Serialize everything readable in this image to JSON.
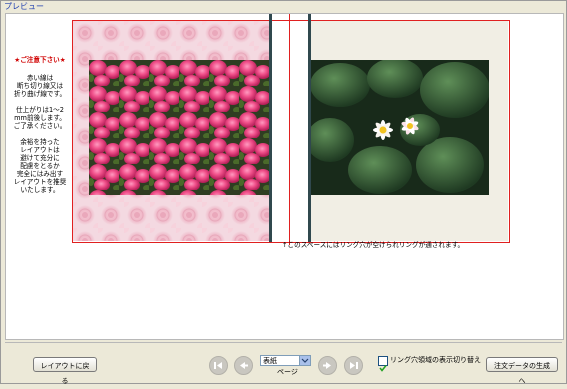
{
  "window": {
    "title": "プレビュー"
  },
  "notice": {
    "heading": "★ご注意下さい★",
    "paragraph1": "赤い線は\n断ち切り線又は\n折り曲げ線です。",
    "paragraph2": "仕上がりは1～2\nmm前後します。\nご了承ください。",
    "paragraph3": "余裕を持った\nレイアウトは\n避けて充分に\n配慮をとるか\n完全にはみ出す\nレイアウトを推奨\nいたします。"
  },
  "ring_note": "↑このスペースにはリング穴が空けられリングが通されます。",
  "controls": {
    "layout_back_label": "レイアウトに戻る",
    "page_select_value": "表紙",
    "page_label": "ページ",
    "ring_toggle_label": "リング穴領域の表示切り替え",
    "ring_toggle_checked": true,
    "generate_label": "注文データの生成へ"
  },
  "icons": {
    "first": "first-page-icon",
    "prev": "previous-page-icon",
    "next": "next-page-icon",
    "last": "last-page-icon",
    "dropdown": "chevron-down-icon",
    "check": "checkmark-icon"
  },
  "colors": {
    "bleed_line": "#e02020",
    "ring_band": "#30484e",
    "title_text": "#2040b0",
    "notice_heading": "#d00000",
    "left_page_bg": "#f4d9e1",
    "right_page_bg": "#f1eee4"
  }
}
